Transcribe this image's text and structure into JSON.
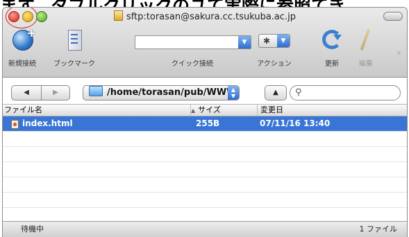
{
  "caption": "ます、タブルクリックのユて実際に参照てき",
  "window": {
    "title": "sftp:torasan@sakura.cc.tsukuba.ac.jp"
  },
  "toolbar": {
    "new_connection_label": "新規接続",
    "bookmark_label": "ブックマーク",
    "quick_connect_label": "クイック接続",
    "quick_connect_value": "",
    "action_label": "アクション",
    "refresh_label": "更新",
    "edit_label": "編集"
  },
  "navigation": {
    "back": "◀",
    "forward": "▶",
    "path": "/home/torasan/pub/WWW",
    "eject": "▲",
    "search_value": ""
  },
  "table": {
    "columns": {
      "name": "ファイル名",
      "size": "サイズ",
      "modified": "変更日"
    },
    "rows": [
      {
        "name": "index.html",
        "size": "255B",
        "modified": "07/11/16 13:40",
        "selected": true
      }
    ]
  },
  "status": {
    "left": "待機中",
    "right": "1 ファイル"
  },
  "colors": {
    "selection": "#3875d7",
    "accent": "#2f6ccf",
    "annotation_circle": "#cc2222"
  },
  "icons": {
    "new_connection": "globe-plus-icon",
    "bookmark": "bookmark-list-icon",
    "action": "gear-icon",
    "refresh": "refresh-icon",
    "edit": "pencil-icon",
    "folder": "folder-icon",
    "file": "html-file-icon",
    "search": "magnifier-icon"
  }
}
